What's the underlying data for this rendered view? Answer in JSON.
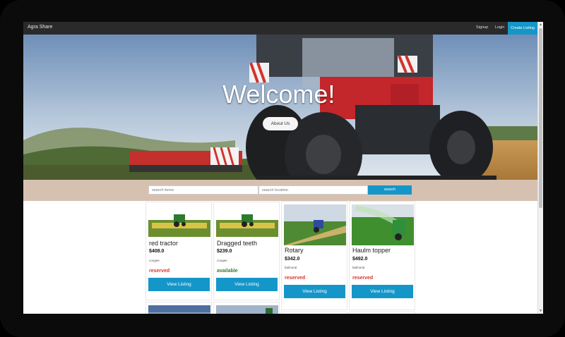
{
  "navbar": {
    "brand": "Agra Share",
    "links": [
      {
        "label": "Signup"
      },
      {
        "label": "Login"
      }
    ],
    "cta_label": "Create Listing"
  },
  "hero": {
    "title": "Welcome!",
    "about_label": "About Us"
  },
  "search": {
    "items_placeholder": "search items",
    "location_placeholder": "search location",
    "button_label": "search"
  },
  "listings": [
    {
      "title": "red tractor",
      "price": "$408.0",
      "location": "coogee",
      "status": "reserved",
      "button": "View Listing"
    },
    {
      "title": "Dragged teeth",
      "price": "$239.0",
      "location": "coogee",
      "status": "available",
      "button": "View Listing"
    },
    {
      "title": "Rotary",
      "price": "$342.0",
      "location": "balmoral",
      "status": "reserved",
      "button": "View Listing"
    },
    {
      "title": "Haulm topper",
      "price": "$492.0",
      "location": "balmoral",
      "status": "reserved",
      "button": "View Listing"
    }
  ],
  "colors": {
    "accent": "#1596c9",
    "navbar": "#2a2a2a",
    "band": "#d6c1b1",
    "reserved": "#d9342b",
    "available": "#2e7d32"
  }
}
